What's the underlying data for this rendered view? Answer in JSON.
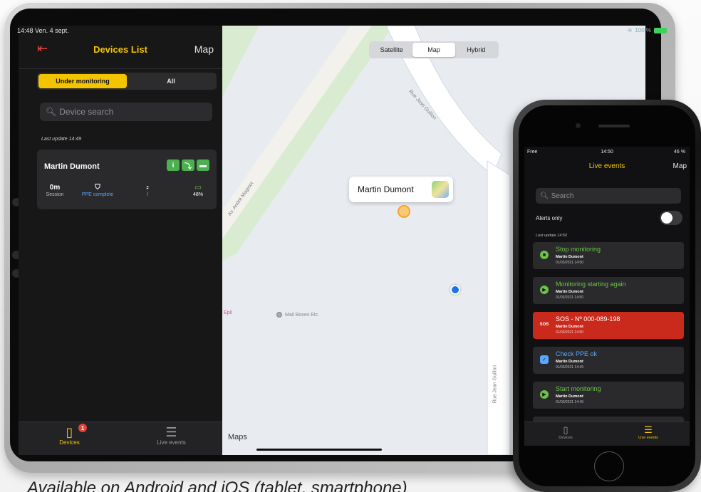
{
  "ipad": {
    "status": {
      "time": "14:48",
      "date": "Ven. 4 sept.",
      "battery": "100 %"
    },
    "left_panel": {
      "title": "Devices List",
      "map_button": "Map",
      "segments": [
        "Under monitoring",
        "All"
      ],
      "search_placeholder": "Device search",
      "last_update": "Last update 14:49",
      "device": {
        "name": "Martin Dumont",
        "session_value": "0m",
        "session_label": "Session",
        "ppe_label": "PPE complete",
        "fall_value": "/",
        "battery": "48%"
      },
      "tabs": [
        {
          "label": "Devices",
          "badge": "1",
          "active": true
        },
        {
          "label": "Live events",
          "active": false
        }
      ]
    },
    "map": {
      "segments": [
        "Satellite",
        "Map",
        "Hybrid"
      ],
      "selected": "Map",
      "callout_name": "Martin Dumont",
      "streets": [
        "Rue Jean Guillon",
        "Av. André Maginot",
        "Rue Jean Guillon"
      ],
      "poi": "Mail Boxes Etc.",
      "epil": "Epil",
      "attribution": "Maps"
    }
  },
  "iphone": {
    "status": {
      "carrier": "Free",
      "time": "14:50",
      "battery": "46 %"
    },
    "title": "Live events",
    "map_button": "Map",
    "search_placeholder": "Search",
    "alerts_only": "Alerts only",
    "last_update": "Last update 14:50",
    "events": [
      {
        "title": "Stop monitoring",
        "name": "Martin Dumont",
        "date": "01/03/2021 14:50",
        "kind": "stop",
        "color": "#6cc24a"
      },
      {
        "title": "Monitoring starting again",
        "name": "Martin Dumont",
        "date": "01/03/2021 14:50",
        "kind": "play",
        "color": "#6cc24a"
      },
      {
        "title": "SOS - Nº 000-089-198",
        "name": "Martin Dumont",
        "date": "01/03/2021 14:50",
        "kind": "sos",
        "icon_text": "SOS",
        "color": "#c92a1b"
      },
      {
        "title": "Check PPE ok",
        "name": "Martin Dumont",
        "date": "01/03/2021 14:49",
        "kind": "shield",
        "color": "#5aa6ff"
      },
      {
        "title": "Start monitoring",
        "name": "Martin Dumont",
        "date": "01/03/2021 14:49",
        "kind": "play",
        "color": "#6cc24a"
      }
    ],
    "tabs": [
      {
        "label": "Devices",
        "active": false
      },
      {
        "label": "Live events",
        "active": true
      }
    ]
  },
  "caption": "Available on Android and iOS (tablet, smartphone)",
  "colors": {
    "accent": "#f5c400",
    "danger": "#e2413a",
    "ok": "#6cc24a",
    "info": "#5aa6ff"
  }
}
